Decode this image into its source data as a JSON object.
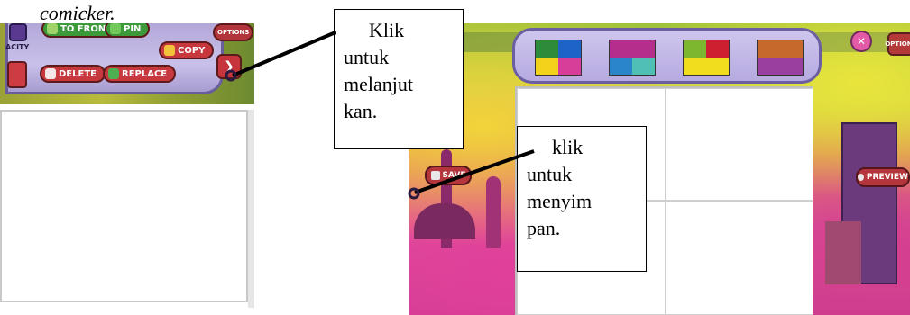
{
  "caption": "comicker.",
  "left_toolbar": {
    "to_front_label": "TO FRONT",
    "pin_label": "PIN",
    "opacity_label": "ACITY",
    "copy_label": "COPY",
    "options_label": "OPTIONS",
    "delete_label": "DELETE",
    "replace_label": "REPLACE"
  },
  "right_toolbar": {
    "close_symbol": "✕",
    "options_label": "OPTIONS",
    "save_label": "SAVE",
    "preview_label": "PREVIEW"
  },
  "callouts": {
    "next": [
      "Klik",
      "untuk",
      "melanjut",
      "kan."
    ],
    "save": [
      "klik",
      "untuk",
      "menyim",
      "pan."
    ]
  },
  "colors": {
    "layout1": [
      "#2e8b3a",
      "#1e63c8",
      "#f3d21c",
      "#d63e9a"
    ],
    "layout2": [
      "#b52e8c",
      "#2a86c9",
      "#4fc0b3"
    ],
    "layout3": [
      "#7db62f",
      "#cc2031",
      "#f1dc1e"
    ],
    "layout4": [
      "#c56a2c",
      "#9a3fa0"
    ]
  }
}
